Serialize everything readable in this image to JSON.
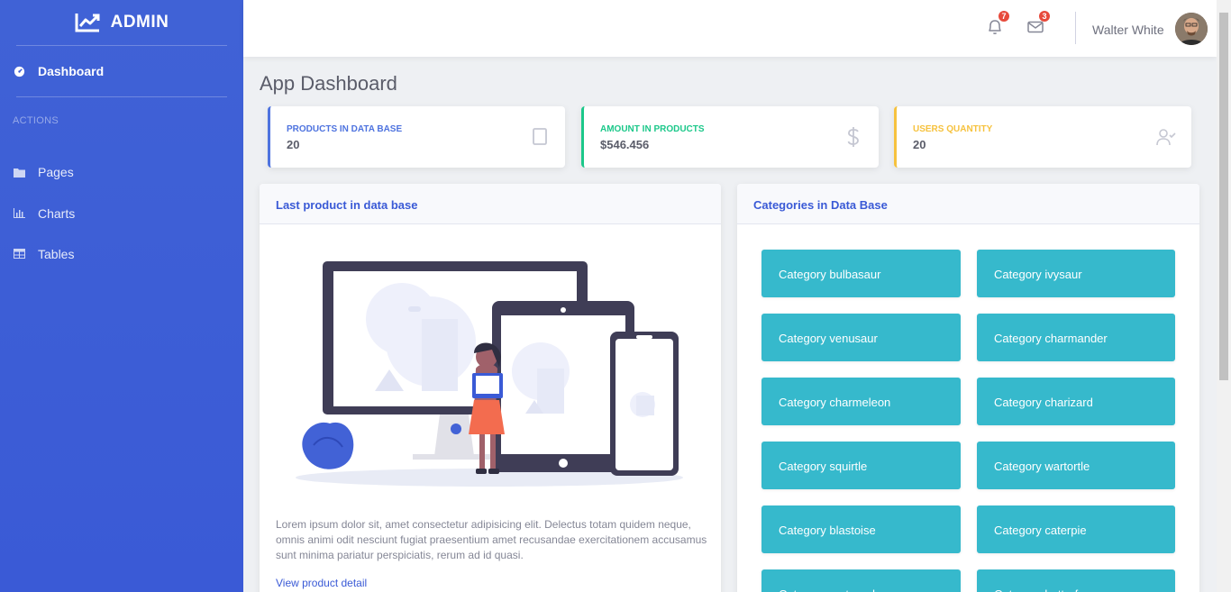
{
  "brand": {
    "title": "ADMIN"
  },
  "sidebar": {
    "dashboard": "Dashboard",
    "heading": "ACTIONS",
    "items": [
      {
        "label": "Pages",
        "icon": "folder-icon"
      },
      {
        "label": "Charts",
        "icon": "chart-bar-icon"
      },
      {
        "label": "Tables",
        "icon": "table-icon"
      }
    ]
  },
  "topbar": {
    "alerts_count": "7",
    "messages_count": "3",
    "user_name": "Walter White"
  },
  "page": {
    "title": "App Dashboard"
  },
  "stats": [
    {
      "label": "PRODUCTS IN DATA BASE",
      "value": "20",
      "color": "#4e73df",
      "icon": "clipboard-icon"
    },
    {
      "label": "AMOUNT IN PRODUCTS",
      "value": "$546.456",
      "color": "#1cc88a",
      "icon": "dollar-icon"
    },
    {
      "label": "USERS QUANTITY",
      "value": "20",
      "color": "#f6c23e",
      "icon": "user-check-icon"
    }
  ],
  "product_card": {
    "title": "Last product in data base",
    "description": "Lorem ipsum dolor sit, amet consectetur adipisicing elit. Delectus totam quidem neque, omnis animi odit nesciunt fugiat praesentium amet recusandae exercitationem accusamus sunt minima pariatur perspiciatis, rerum ad id quasi.",
    "link": "View product detail"
  },
  "categories_card": {
    "title": "Categories in Data Base",
    "items": [
      "Category bulbasaur",
      "Category ivysaur",
      "Category venusaur",
      "Category charmander",
      "Category charmeleon",
      "Category charizard",
      "Category squirtle",
      "Category wartortle",
      "Category blastoise",
      "Category caterpie",
      "Category metapod",
      "Category butterfree"
    ]
  }
}
